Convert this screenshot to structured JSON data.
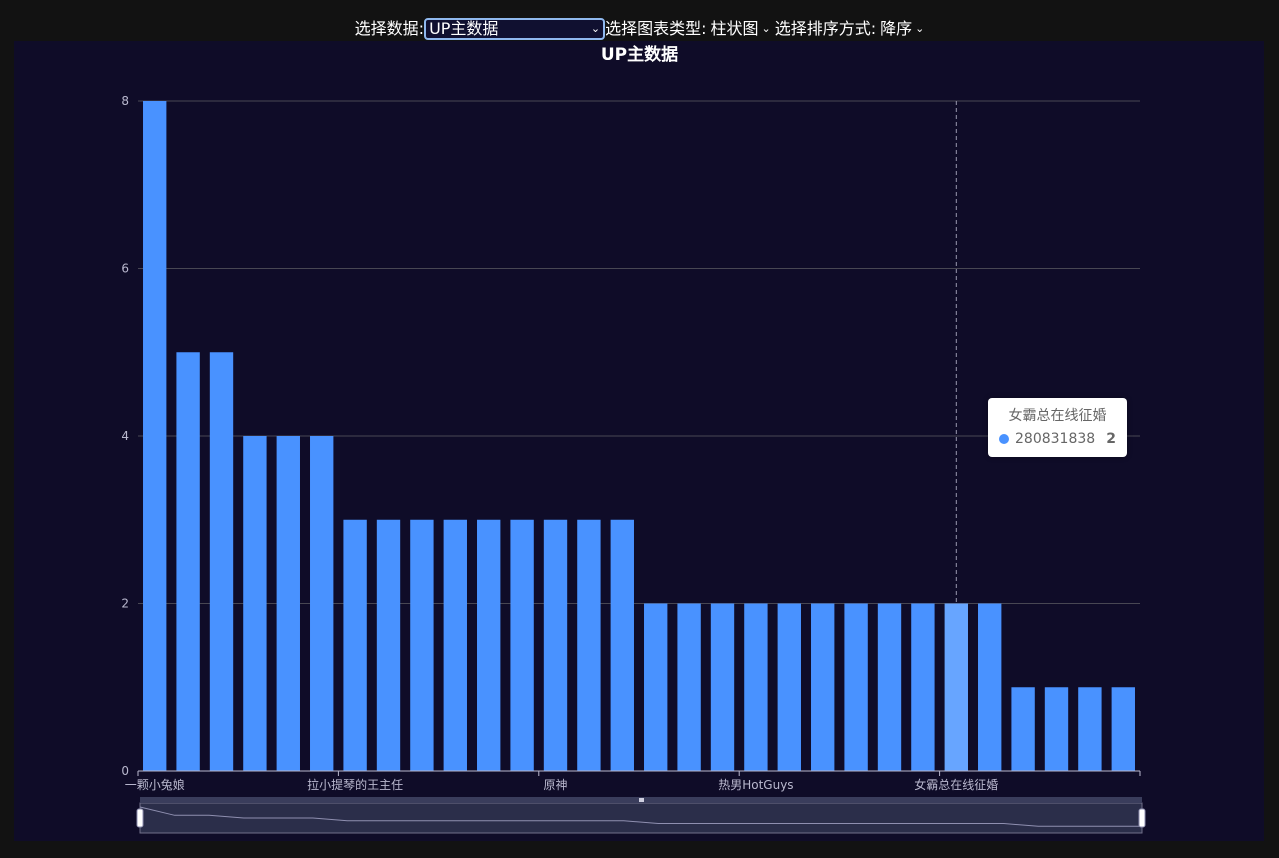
{
  "controls": {
    "data_label": "选择数据:",
    "data_value": "UP主数据",
    "type_label": "选择图表类型:",
    "type_value": "柱状图",
    "sort_label": "选择排序方式:",
    "sort_value": "降序"
  },
  "chart_data": {
    "type": "bar",
    "title": "UP主数据",
    "xlabel": "",
    "ylabel": "",
    "ylim": [
      0,
      8
    ],
    "yticks": [
      0,
      2,
      4,
      6,
      8
    ],
    "grid": true,
    "visible_category_labels": [
      "一颗小兔娘",
      "拉小提琴的王主任",
      "原神",
      "热男HotGuys",
      "女霸总在线征婚"
    ],
    "label_positions_index": [
      0,
      6,
      12,
      18,
      24
    ],
    "values": [
      8,
      5,
      5,
      4,
      4,
      4,
      3,
      3,
      3,
      3,
      3,
      3,
      3,
      3,
      3,
      2,
      2,
      2,
      2,
      2,
      2,
      2,
      2,
      2,
      2,
      2,
      1,
      1,
      1,
      1
    ],
    "highlight_index": 24,
    "series": [
      {
        "name": "280831838"
      }
    ],
    "colors": {
      "bar": "#4992ff",
      "bar_highlight": "#67a5ff"
    }
  },
  "tooltip": {
    "title": "女霸总在线征婚",
    "series_name": "280831838",
    "value": "2"
  },
  "datazoom": {
    "start_percent": 0,
    "end_percent": 100
  }
}
